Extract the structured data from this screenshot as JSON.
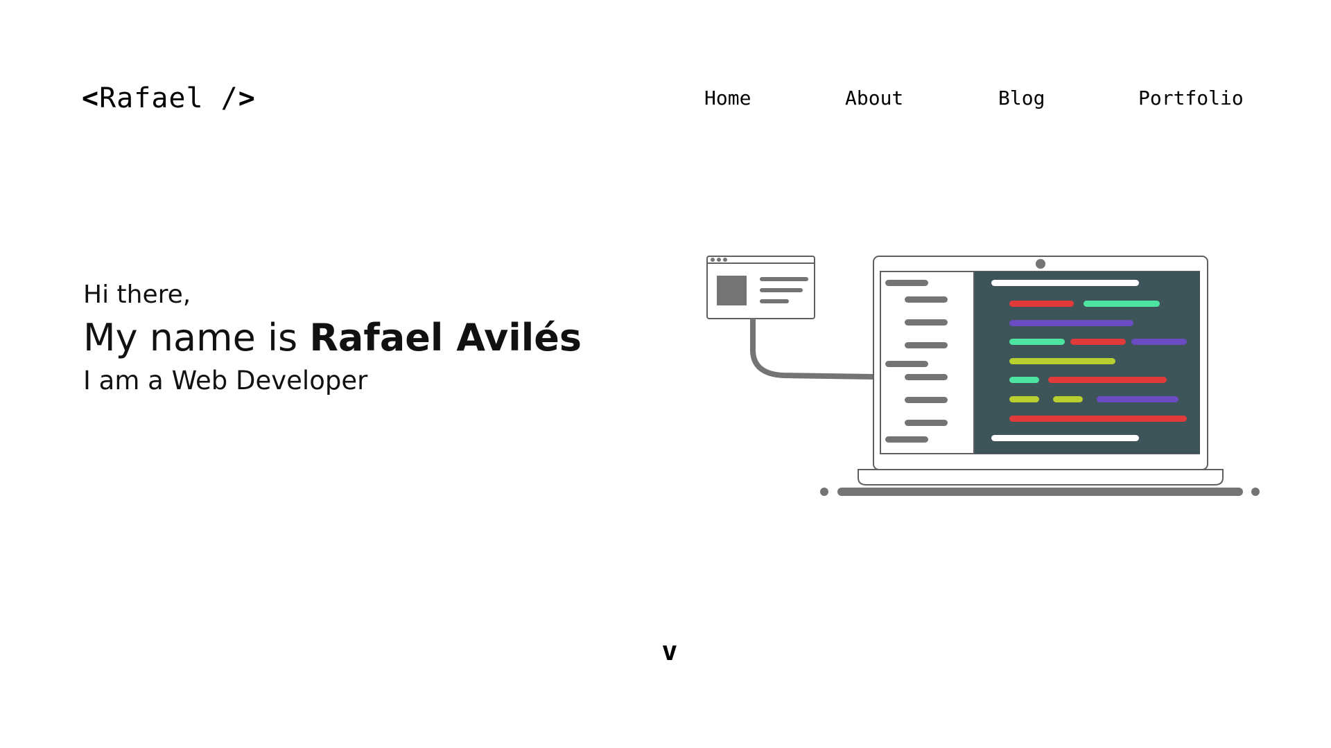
{
  "header": {
    "logo": {
      "open": "<",
      "name": "Rafael /",
      "close": ">"
    },
    "nav": [
      {
        "label": "Home"
      },
      {
        "label": "About"
      },
      {
        "label": "Blog"
      },
      {
        "label": "Portfolio"
      }
    ]
  },
  "hero": {
    "greeting": "Hi there,",
    "name_prefix": "My name is",
    "name": "Rafael Avilés",
    "role": "I am a Web Developer"
  },
  "scroll_indicator": "v",
  "illustration": {
    "icon": "laptop-code-illustration",
    "colors": {
      "outline": "#5f5f5f",
      "gray": "#747474",
      "editor_bg": "#3d5558",
      "red": "#e03a3a",
      "green": "#4de3a0",
      "purple": "#6a4bc2",
      "lime": "#b8cf30",
      "white": "#ffffff"
    }
  }
}
